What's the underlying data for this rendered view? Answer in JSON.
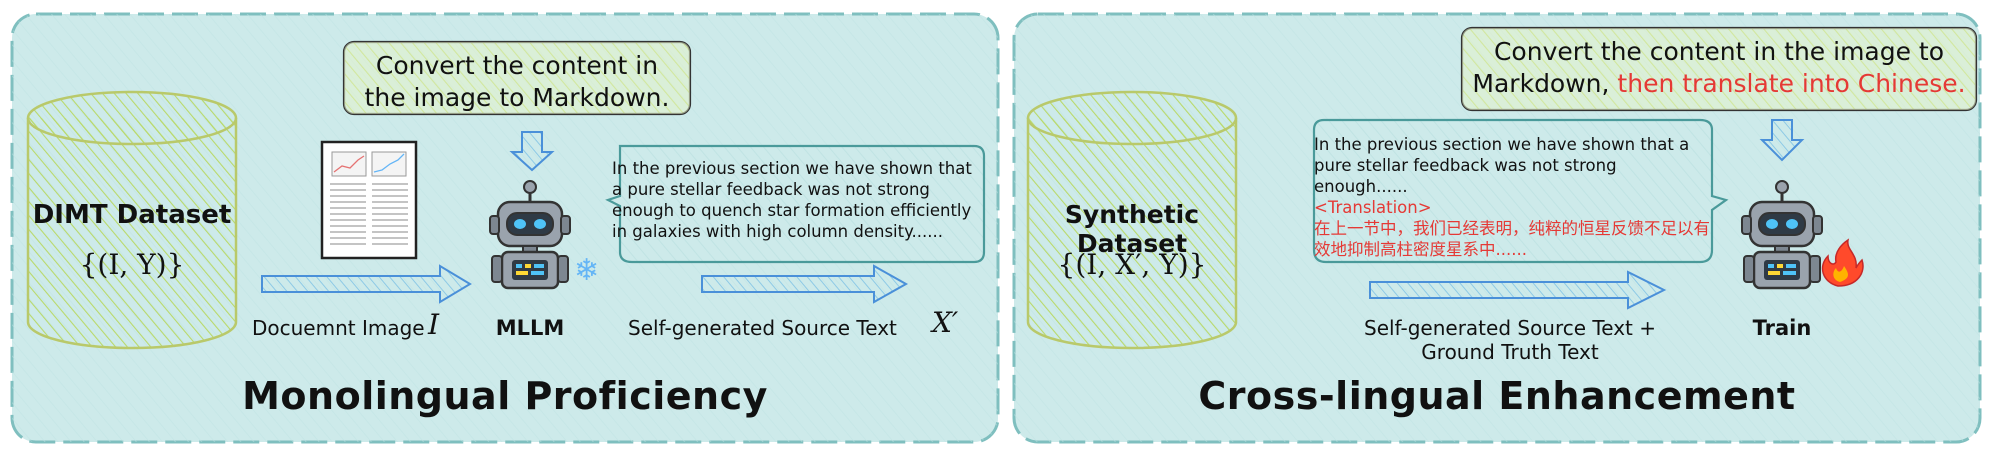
{
  "left_panel": {
    "title": "Monolingual Proficiency",
    "dataset_name": "DIMT Dataset",
    "dataset_formula": "{(I, Y)}",
    "prompt": "Convert the content in the image to Markdown.",
    "input_label": "Docuemnt Image",
    "input_symbol": "I",
    "model_label": "MLLM",
    "output_text": "In the previous section we have shown that a pure stellar feedback was not strong enough to quench star formation efficiently in galaxies with high column density......",
    "output_label": "Self-generated Source Text",
    "output_symbol": "X′",
    "colors": {
      "panel_fill": "#cdeaea",
      "panel_border": "#7fbfbf",
      "hatch": "#b9d96a",
      "arrow": "#4a90d9"
    }
  },
  "right_panel": {
    "title": "Cross-lingual Enhancement",
    "dataset_name": "Synthetic Dataset",
    "dataset_formula": "{(I, X′, Y)}",
    "prompt_part1": "Convert the content in the image to Markdown, ",
    "prompt_part2": "then translate into Chinese.",
    "box_text_en": "In the previous section we have shown that a pure stellar feedback was not strong enough......",
    "box_tag": "<Translation>",
    "box_text_zh": "在上一节中，我们已经表明，纯粹的恒星反馈不足以有效地抑制高柱密度星系中......",
    "arrow_label_line1": "Self-generated Source Text +",
    "arrow_label_line2": "Ground Truth Text",
    "model_label": "Train",
    "colors": {
      "highlight": "#e53935",
      "fire": "#ff4a2b"
    }
  }
}
